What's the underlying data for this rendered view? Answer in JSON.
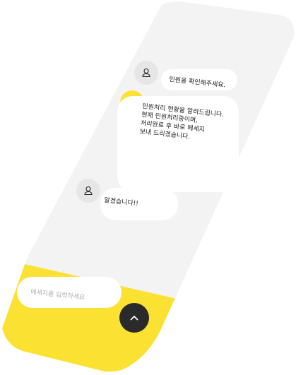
{
  "colors": {
    "screen_bg": "#f3f3f3",
    "composer_bg": "#fbe232",
    "bubble_bg": "#ffffff",
    "avatar_gray": "#e6e6e6",
    "avatar_yellow": "#fbe232",
    "send_button": "#2a2a2a"
  },
  "messages": [
    {
      "avatar": "user-icon",
      "avatar_style": "gray",
      "text": "민원을 확인해주세요."
    },
    {
      "avatar": "user-icon",
      "avatar_style": "yellow",
      "text": "민원처리 현황을 알려드립니다.\n현재 민원처리중이며,\n처리완료 후 바로 메세지\n보내 드리겠습니다."
    },
    {
      "avatar": "user-icon",
      "avatar_style": "gray",
      "text": "알겠습니다!!"
    }
  ],
  "composer": {
    "placeholder": "메세지를 입력하세요",
    "send_icon": "chevron-up-icon"
  }
}
